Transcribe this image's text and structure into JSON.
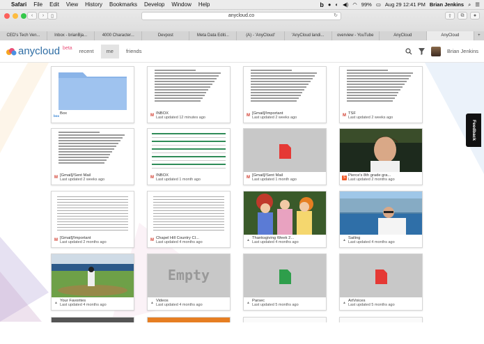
{
  "menubar": {
    "app": "Safari",
    "menus": [
      "File",
      "Edit",
      "View",
      "History",
      "Bookmarks",
      "Develop",
      "Window",
      "Help"
    ],
    "battery": "99%",
    "datetime": "Aug 29  12:41 PM",
    "user": "Brian Jenkins"
  },
  "browser": {
    "url": "anycloud.co",
    "tabs": [
      "CED's Tech Ven...",
      "Inbox - brianBja...",
      "4000 Character...",
      "Devpost",
      "Meta Data Editi...",
      "(A) - 'AnyCloud'",
      "'AnyCloud landi...",
      "overview - YouTube",
      "AnyCloud",
      "AnyCloud"
    ],
    "active_tab_index": 9
  },
  "app": {
    "logo": "anycloud",
    "beta": "beta",
    "nav": [
      "recent",
      "me",
      "friends"
    ],
    "active_nav": "me",
    "user_name": "Brian Jenkins",
    "feedback_label": "Feedback"
  },
  "cards": [
    {
      "name": "Box",
      "sub": "",
      "source": "box",
      "source_label": "box",
      "thumb": "folder"
    },
    {
      "name": "INBOX",
      "sub": "Last updated 12 minutes ago",
      "source": "gmail",
      "source_label": "M",
      "thumb": "doc"
    },
    {
      "name": "[Gmail]/Important",
      "sub": "Last updated 2 weeks ago",
      "source": "gmail",
      "source_label": "M",
      "thumb": "doc"
    },
    {
      "name": "TSF",
      "sub": "Last updated 2 weeks ago",
      "source": "gmail",
      "source_label": "M",
      "thumb": "doc"
    },
    {
      "name": "[Gmail]/Sent Mail",
      "sub": "Last updated 2 weeks ago",
      "source": "gmail",
      "source_label": "M",
      "thumb": "doc"
    },
    {
      "name": "INBOX",
      "sub": "Last updated 1 month ago",
      "source": "gmail",
      "source_label": "M",
      "thumb": "sheet"
    },
    {
      "name": "[Gmail]/Sent Mail",
      "sub": "Last updated 1 month ago",
      "source": "gmail",
      "source_label": "M",
      "thumb": "pdf"
    },
    {
      "name": "Pierce's 8th grade gra...",
      "sub": "Last updated 2 months ago",
      "source": "sh",
      "source_label": "S",
      "thumb": "portrait"
    },
    {
      "name": "[Gmail]/Important",
      "sub": "Last updated 2 months ago",
      "source": "gmail",
      "source_label": "M",
      "thumb": "table"
    },
    {
      "name": "Chapel Hill Country Cl...",
      "sub": "Last updated 4 months ago",
      "source": "gmail",
      "source_label": "M",
      "thumb": "table"
    },
    {
      "name": "Thanksgiving Week 2...",
      "sub": "Last updated 4 months ago",
      "source": "gd",
      "source_label": "▲",
      "thumb": "photo-kids"
    },
    {
      "name": "Sailing",
      "sub": "Last updated 4 months ago",
      "source": "gd",
      "source_label": "▲",
      "thumb": "photo-sail"
    },
    {
      "name": "Your Favorites",
      "sub": "Last updated 4 months ago",
      "source": "gd",
      "source_label": "▲",
      "thumb": "photo-baseball"
    },
    {
      "name": "Videos",
      "sub": "Last updated 4 months ago",
      "source": "gd",
      "source_label": "▲",
      "thumb": "empty"
    },
    {
      "name": "Parsec",
      "sub": "Last updated 5 months ago",
      "source": "gd",
      "source_label": "▲",
      "thumb": "sheeticon"
    },
    {
      "name": "ArtVoices",
      "sub": "Last updated 5 months ago",
      "source": "gd",
      "source_label": "▲",
      "thumb": "pdf"
    }
  ],
  "empty_label": "Empty",
  "colors": {
    "accent": "#2e6da4",
    "beta": "#e94e77",
    "gmail": "#d23f31",
    "pdf": "#e53935",
    "sheet": "#2e9e4b"
  }
}
